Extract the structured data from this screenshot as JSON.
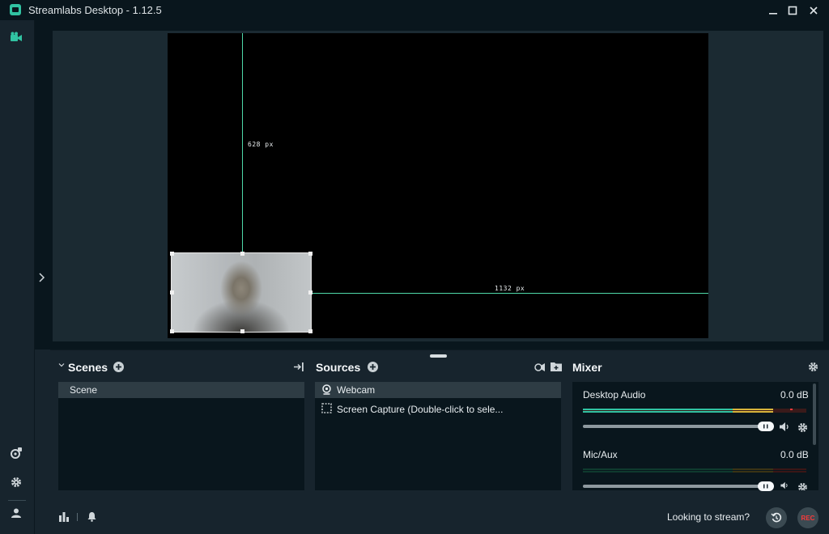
{
  "window": {
    "title": "Streamlabs Desktop - 1.12.5"
  },
  "canvas": {
    "height_label": "628 px",
    "width_label": "1132 px"
  },
  "scenes": {
    "title": "Scenes",
    "items": [
      "Scene"
    ]
  },
  "sources": {
    "title": "Sources",
    "items": [
      "Webcam",
      "Screen Capture (Double-click to sele..."
    ]
  },
  "mixer": {
    "title": "Mixer",
    "channels": [
      {
        "name": "Desktop Audio",
        "level": "0.0 dB"
      },
      {
        "name": "Mic/Aux",
        "level": "0.0 dB"
      }
    ]
  },
  "footer": {
    "prompt": "Looking to stream?",
    "rec_label": "REC"
  },
  "colors": {
    "accent": "#31c3a2",
    "background": "#17242d",
    "panel": "#09161d",
    "record": "#fb3a3a"
  }
}
